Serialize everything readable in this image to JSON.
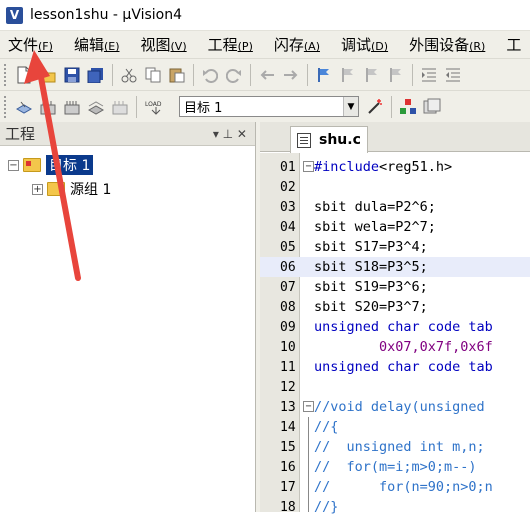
{
  "window": {
    "title": "lesson1shu - µVision4",
    "app_icon": "V"
  },
  "menu": [
    {
      "label": "文件",
      "accel": "(F)"
    },
    {
      "label": "编辑",
      "accel": "(E)"
    },
    {
      "label": "视图",
      "accel": "(V)"
    },
    {
      "label": "工程",
      "accel": "(P)"
    },
    {
      "label": "闪存",
      "accel": "(A)"
    },
    {
      "label": "调试",
      "accel": "(D)"
    },
    {
      "label": "外围设备",
      "accel": "(R)"
    },
    {
      "label": "工",
      "accel": ""
    }
  ],
  "toolbar2": {
    "target_select": "目标 1",
    "load_label": "LOAD"
  },
  "project_pane": {
    "title": "工程",
    "pin_glyph": "▾ ⊥ ✕",
    "tree": [
      {
        "label": "目标 1",
        "expander": "⊟"
      },
      {
        "label": "源组 1",
        "expander": "⊞"
      }
    ]
  },
  "editor": {
    "tab_label": "shu.c",
    "lines": [
      {
        "n": "01",
        "text": "#include<reg51.h>"
      },
      {
        "n": "02",
        "text": ""
      },
      {
        "n": "03",
        "text": "sbit dula=P2^6;"
      },
      {
        "n": "04",
        "text": "sbit wela=P2^7;"
      },
      {
        "n": "05",
        "text": "sbit S17=P3^4;"
      },
      {
        "n": "06",
        "text": "sbit S18=P3^5;"
      },
      {
        "n": "07",
        "text": "sbit S19=P3^6;"
      },
      {
        "n": "08",
        "text": "sbit S20=P3^7;"
      },
      {
        "n": "09",
        "text": "unsigned char code tab"
      },
      {
        "n": "10",
        "text": "        0x07,0x7f,0x6f"
      },
      {
        "n": "11",
        "text": "unsigned char code tab"
      },
      {
        "n": "12",
        "text": ""
      },
      {
        "n": "13",
        "text": "//void delay(unsigned"
      },
      {
        "n": "14",
        "text": "//{"
      },
      {
        "n": "15",
        "text": "//  unsigned int m,n;"
      },
      {
        "n": "16",
        "text": "//  for(m=i;m>0;m--)"
      },
      {
        "n": "17",
        "text": "//      for(n=90;n>0;n"
      },
      {
        "n": "18",
        "text": "//}"
      }
    ],
    "highlighted_line": "06"
  },
  "colors": {
    "accent_arrow": "#e8453c",
    "keyword": "#0000c0",
    "number": "#800080",
    "comment": "#2f73c9",
    "selection": "#0b3a8c",
    "highlight_line": "#e8ecfa"
  }
}
